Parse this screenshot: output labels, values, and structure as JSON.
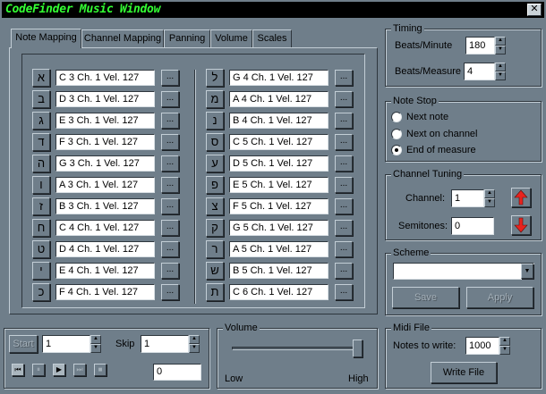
{
  "window": {
    "title": "CodeFinder Music Window",
    "close_glyph": "✕"
  },
  "tabs": [
    {
      "label": "Note Mapping",
      "active": true
    },
    {
      "label": "Channel Mapping",
      "active": false
    },
    {
      "label": "Panning",
      "active": false
    },
    {
      "label": "Volume",
      "active": false
    },
    {
      "label": "Scales",
      "active": false
    }
  ],
  "note_mapping": {
    "more_label": "...",
    "left": [
      {
        "key": "א",
        "value": "C 3 Ch. 1 Vel. 127"
      },
      {
        "key": "ב",
        "value": "D 3 Ch. 1 Vel. 127"
      },
      {
        "key": "ג",
        "value": "E 3 Ch. 1 Vel. 127"
      },
      {
        "key": "ד",
        "value": "F 3 Ch. 1 Vel. 127"
      },
      {
        "key": "ה",
        "value": "G 3 Ch. 1 Vel. 127"
      },
      {
        "key": "ו",
        "value": "A 3 Ch. 1 Vel. 127"
      },
      {
        "key": "ז",
        "value": "B 3 Ch. 1 Vel. 127"
      },
      {
        "key": "ח",
        "value": "C 4 Ch. 1 Vel. 127"
      },
      {
        "key": "ט",
        "value": "D 4 Ch. 1 Vel. 127"
      },
      {
        "key": "י",
        "value": "E 4 Ch. 1 Vel. 127"
      },
      {
        "key": "כ",
        "value": "F 4 Ch. 1 Vel. 127"
      }
    ],
    "right": [
      {
        "key": "ל",
        "value": "G 4 Ch. 1 Vel. 127"
      },
      {
        "key": "מ",
        "value": "A 4 Ch. 1 Vel. 127"
      },
      {
        "key": "נ",
        "value": "B 4 Ch. 1 Vel. 127"
      },
      {
        "key": "ס",
        "value": "C 5 Ch. 1 Vel. 127"
      },
      {
        "key": "ע",
        "value": "D 5 Ch. 1 Vel. 127"
      },
      {
        "key": "פ",
        "value": "E 5 Ch. 1 Vel. 127"
      },
      {
        "key": "צ",
        "value": "F 5 Ch. 1 Vel. 127"
      },
      {
        "key": "ק",
        "value": "G 5 Ch. 1 Vel. 127"
      },
      {
        "key": "ר",
        "value": "A 5 Ch. 1 Vel. 127"
      },
      {
        "key": "ש",
        "value": "B 5 Ch. 1 Vel. 127"
      },
      {
        "key": "ת",
        "value": "C 6 Ch. 1 Vel. 127"
      }
    ]
  },
  "timing": {
    "title": "Timing",
    "bpm_label": "Beats/Minute",
    "bpm_value": "180",
    "bpmeasure_label": "Beats/Measure",
    "bpmeasure_value": "4"
  },
  "note_stop": {
    "title": "Note Stop",
    "options": [
      {
        "label": "Next note",
        "checked": false
      },
      {
        "label": "Next on channel",
        "checked": false
      },
      {
        "label": "End of measure",
        "checked": true
      }
    ]
  },
  "channel_tuning": {
    "title": "Channel Tuning",
    "channel_label": "Channel:",
    "channel_value": "1",
    "semitones_label": "Semitones:",
    "semitones_value": "0",
    "arrow_color": "#e8231e"
  },
  "scheme": {
    "title": "Scheme",
    "selected": "",
    "save_label": "Save",
    "apply_label": "Apply"
  },
  "playback": {
    "start_label": "Start",
    "start_value": "1",
    "skip_label": "Skip",
    "skip_value": "1",
    "position_value": "0"
  },
  "volume": {
    "title": "Volume",
    "low_label": "Low",
    "high_label": "High",
    "level": 1.0
  },
  "midi_file": {
    "title": "Midi File",
    "notes_label": "Notes to write:",
    "notes_value": "1000",
    "write_label": "Write File"
  }
}
